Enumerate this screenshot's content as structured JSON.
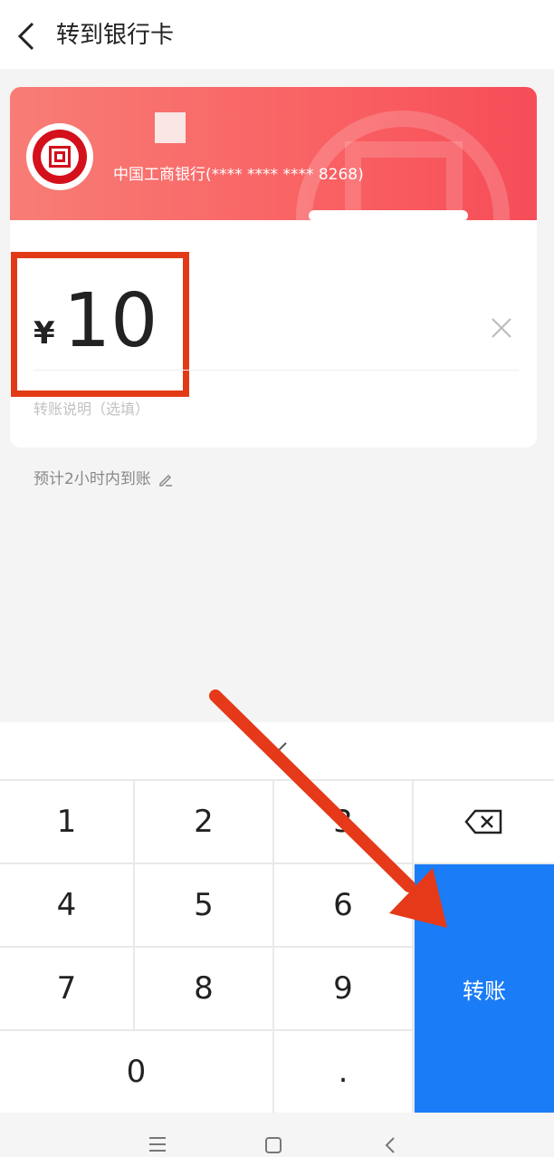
{
  "header": {
    "title": "转到银行卡"
  },
  "bank": {
    "name": "中国工商银行(**** **** **** 8268)"
  },
  "amount": {
    "currency": "¥",
    "value": "10"
  },
  "memo": {
    "placeholder": "转账说明（选填）"
  },
  "eta": {
    "text": "预计2小时内到账"
  },
  "keypad": {
    "keys": [
      "1",
      "2",
      "3",
      "4",
      "5",
      "6",
      "7",
      "8",
      "9",
      "0",
      "."
    ],
    "transfer_label": "转账"
  },
  "colors": {
    "accent": "#1b7cf7",
    "banner": "#f96163",
    "highlight": "#e23a17"
  },
  "icons": [
    "back-arrow-icon",
    "bank-logo-icon",
    "clear-icon",
    "edit-icon",
    "backspace-icon",
    "menu-icon",
    "home-icon",
    "back-icon"
  ]
}
